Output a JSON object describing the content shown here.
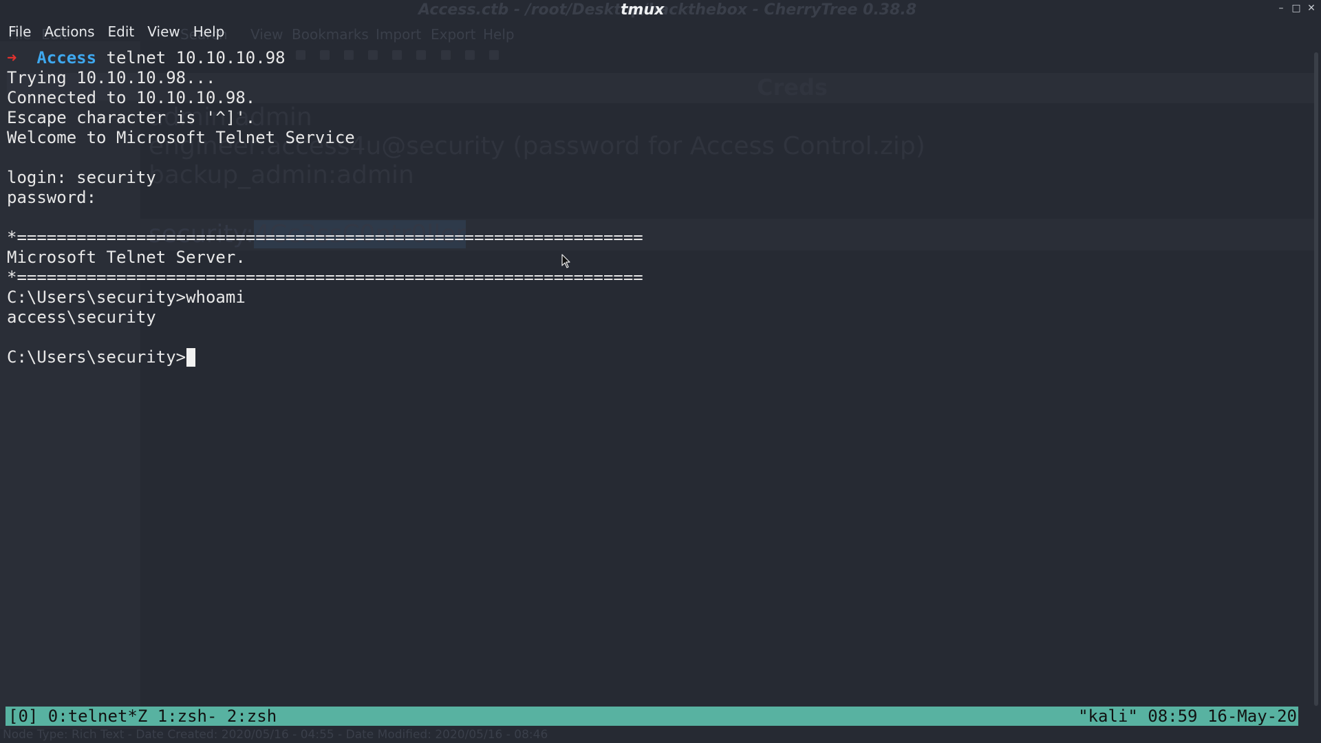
{
  "background_app": {
    "window_title": "Access.ctb - /root/Desktop/hackthebox - CherryTree 0.38.8",
    "menu": [
      "File",
      "Edit",
      "Search",
      "View",
      "Bookmarks",
      "Import",
      "Export",
      "Help"
    ],
    "node_title": "Creds",
    "note_lines": [
      "admin:admin",
      "engineer:access4u@security (password for Access Control.zip)",
      "backup_admin:admin"
    ],
    "highlight_user": "security:",
    "highlight_password": "4Cc3ssC0ntr0ller",
    "statusbar": "Node Type: Rich Text  -  Date Created: 2020/05/16 - 04:55  -  Date Modified: 2020/05/16 - 08:46"
  },
  "window": {
    "title": "tmux",
    "minimize": "–",
    "maximize": "□",
    "close": "✕"
  },
  "menu": {
    "file": "File",
    "actions": "Actions",
    "edit": "Edit",
    "view": "View",
    "help": "Help"
  },
  "terminal": {
    "prompt_arrow": "➜",
    "prompt_dir": "Access",
    "command": " telnet 10.10.10.98",
    "lines": [
      "Trying 10.10.10.98...",
      "Connected to 10.10.10.98.",
      "Escape character is '^]'.",
      "Welcome to Microsoft Telnet Service",
      "",
      "login: security",
      "password:",
      "",
      "*===============================================================",
      "Microsoft Telnet Server.",
      "*===============================================================",
      "C:\\Users\\security>whoami",
      "access\\security",
      ""
    ],
    "current_prompt": "C:\\Users\\security>"
  },
  "tmux": {
    "session": "[0]",
    "windows": " 0:telnet*Z 1:zsh- 2:zsh",
    "right": "\"kali\" 08:59 16-May-20"
  },
  "icons": {
    "mouse": "arrow-pointer-icon",
    "prompt": "right-arrow-icon"
  },
  "colors": {
    "background": "#262a33",
    "prompt_arrow": "#e3322e",
    "prompt_dir": "#3ea8ef",
    "tmux_status": "#58b2a1"
  }
}
